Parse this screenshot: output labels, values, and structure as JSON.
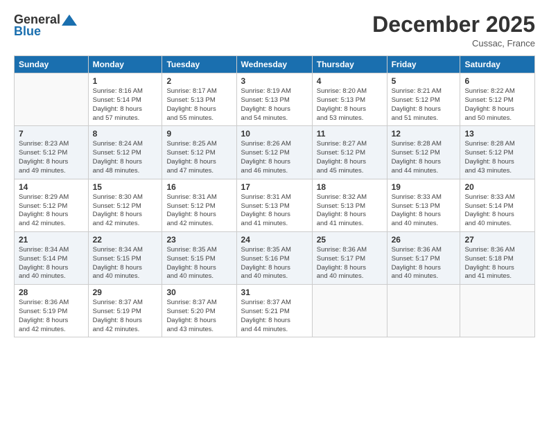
{
  "header": {
    "logo_general": "General",
    "logo_blue": "Blue",
    "month": "December 2025",
    "location": "Cussac, France"
  },
  "weekdays": [
    "Sunday",
    "Monday",
    "Tuesday",
    "Wednesday",
    "Thursday",
    "Friday",
    "Saturday"
  ],
  "weeks": [
    [
      {
        "day": "",
        "sunrise": "",
        "sunset": "",
        "daylight": ""
      },
      {
        "day": "1",
        "sunrise": "Sunrise: 8:16 AM",
        "sunset": "Sunset: 5:14 PM",
        "daylight": "Daylight: 8 hours and 57 minutes."
      },
      {
        "day": "2",
        "sunrise": "Sunrise: 8:17 AM",
        "sunset": "Sunset: 5:13 PM",
        "daylight": "Daylight: 8 hours and 55 minutes."
      },
      {
        "day": "3",
        "sunrise": "Sunrise: 8:19 AM",
        "sunset": "Sunset: 5:13 PM",
        "daylight": "Daylight: 8 hours and 54 minutes."
      },
      {
        "day": "4",
        "sunrise": "Sunrise: 8:20 AM",
        "sunset": "Sunset: 5:13 PM",
        "daylight": "Daylight: 8 hours and 53 minutes."
      },
      {
        "day": "5",
        "sunrise": "Sunrise: 8:21 AM",
        "sunset": "Sunset: 5:12 PM",
        "daylight": "Daylight: 8 hours and 51 minutes."
      },
      {
        "day": "6",
        "sunrise": "Sunrise: 8:22 AM",
        "sunset": "Sunset: 5:12 PM",
        "daylight": "Daylight: 8 hours and 50 minutes."
      }
    ],
    [
      {
        "day": "7",
        "sunrise": "Sunrise: 8:23 AM",
        "sunset": "Sunset: 5:12 PM",
        "daylight": "Daylight: 8 hours and 49 minutes."
      },
      {
        "day": "8",
        "sunrise": "Sunrise: 8:24 AM",
        "sunset": "Sunset: 5:12 PM",
        "daylight": "Daylight: 8 hours and 48 minutes."
      },
      {
        "day": "9",
        "sunrise": "Sunrise: 8:25 AM",
        "sunset": "Sunset: 5:12 PM",
        "daylight": "Daylight: 8 hours and 47 minutes."
      },
      {
        "day": "10",
        "sunrise": "Sunrise: 8:26 AM",
        "sunset": "Sunset: 5:12 PM",
        "daylight": "Daylight: 8 hours and 46 minutes."
      },
      {
        "day": "11",
        "sunrise": "Sunrise: 8:27 AM",
        "sunset": "Sunset: 5:12 PM",
        "daylight": "Daylight: 8 hours and 45 minutes."
      },
      {
        "day": "12",
        "sunrise": "Sunrise: 8:28 AM",
        "sunset": "Sunset: 5:12 PM",
        "daylight": "Daylight: 8 hours and 44 minutes."
      },
      {
        "day": "13",
        "sunrise": "Sunrise: 8:28 AM",
        "sunset": "Sunset: 5:12 PM",
        "daylight": "Daylight: 8 hours and 43 minutes."
      }
    ],
    [
      {
        "day": "14",
        "sunrise": "Sunrise: 8:29 AM",
        "sunset": "Sunset: 5:12 PM",
        "daylight": "Daylight: 8 hours and 42 minutes."
      },
      {
        "day": "15",
        "sunrise": "Sunrise: 8:30 AM",
        "sunset": "Sunset: 5:12 PM",
        "daylight": "Daylight: 8 hours and 42 minutes."
      },
      {
        "day": "16",
        "sunrise": "Sunrise: 8:31 AM",
        "sunset": "Sunset: 5:12 PM",
        "daylight": "Daylight: 8 hours and 42 minutes."
      },
      {
        "day": "17",
        "sunrise": "Sunrise: 8:31 AM",
        "sunset": "Sunset: 5:13 PM",
        "daylight": "Daylight: 8 hours and 41 minutes."
      },
      {
        "day": "18",
        "sunrise": "Sunrise: 8:32 AM",
        "sunset": "Sunset: 5:13 PM",
        "daylight": "Daylight: 8 hours and 41 minutes."
      },
      {
        "day": "19",
        "sunrise": "Sunrise: 8:33 AM",
        "sunset": "Sunset: 5:13 PM",
        "daylight": "Daylight: 8 hours and 40 minutes."
      },
      {
        "day": "20",
        "sunrise": "Sunrise: 8:33 AM",
        "sunset": "Sunset: 5:14 PM",
        "daylight": "Daylight: 8 hours and 40 minutes."
      }
    ],
    [
      {
        "day": "21",
        "sunrise": "Sunrise: 8:34 AM",
        "sunset": "Sunset: 5:14 PM",
        "daylight": "Daylight: 8 hours and 40 minutes."
      },
      {
        "day": "22",
        "sunrise": "Sunrise: 8:34 AM",
        "sunset": "Sunset: 5:15 PM",
        "daylight": "Daylight: 8 hours and 40 minutes."
      },
      {
        "day": "23",
        "sunrise": "Sunrise: 8:35 AM",
        "sunset": "Sunset: 5:15 PM",
        "daylight": "Daylight: 8 hours and 40 minutes."
      },
      {
        "day": "24",
        "sunrise": "Sunrise: 8:35 AM",
        "sunset": "Sunset: 5:16 PM",
        "daylight": "Daylight: 8 hours and 40 minutes."
      },
      {
        "day": "25",
        "sunrise": "Sunrise: 8:36 AM",
        "sunset": "Sunset: 5:17 PM",
        "daylight": "Daylight: 8 hours and 40 minutes."
      },
      {
        "day": "26",
        "sunrise": "Sunrise: 8:36 AM",
        "sunset": "Sunset: 5:17 PM",
        "daylight": "Daylight: 8 hours and 40 minutes."
      },
      {
        "day": "27",
        "sunrise": "Sunrise: 8:36 AM",
        "sunset": "Sunset: 5:18 PM",
        "daylight": "Daylight: 8 hours and 41 minutes."
      }
    ],
    [
      {
        "day": "28",
        "sunrise": "Sunrise: 8:36 AM",
        "sunset": "Sunset: 5:19 PM",
        "daylight": "Daylight: 8 hours and 42 minutes."
      },
      {
        "day": "29",
        "sunrise": "Sunrise: 8:37 AM",
        "sunset": "Sunset: 5:19 PM",
        "daylight": "Daylight: 8 hours and 42 minutes."
      },
      {
        "day": "30",
        "sunrise": "Sunrise: 8:37 AM",
        "sunset": "Sunset: 5:20 PM",
        "daylight": "Daylight: 8 hours and 43 minutes."
      },
      {
        "day": "31",
        "sunrise": "Sunrise: 8:37 AM",
        "sunset": "Sunset: 5:21 PM",
        "daylight": "Daylight: 8 hours and 44 minutes."
      },
      {
        "day": "",
        "sunrise": "",
        "sunset": "",
        "daylight": ""
      },
      {
        "day": "",
        "sunrise": "",
        "sunset": "",
        "daylight": ""
      },
      {
        "day": "",
        "sunrise": "",
        "sunset": "",
        "daylight": ""
      }
    ]
  ]
}
